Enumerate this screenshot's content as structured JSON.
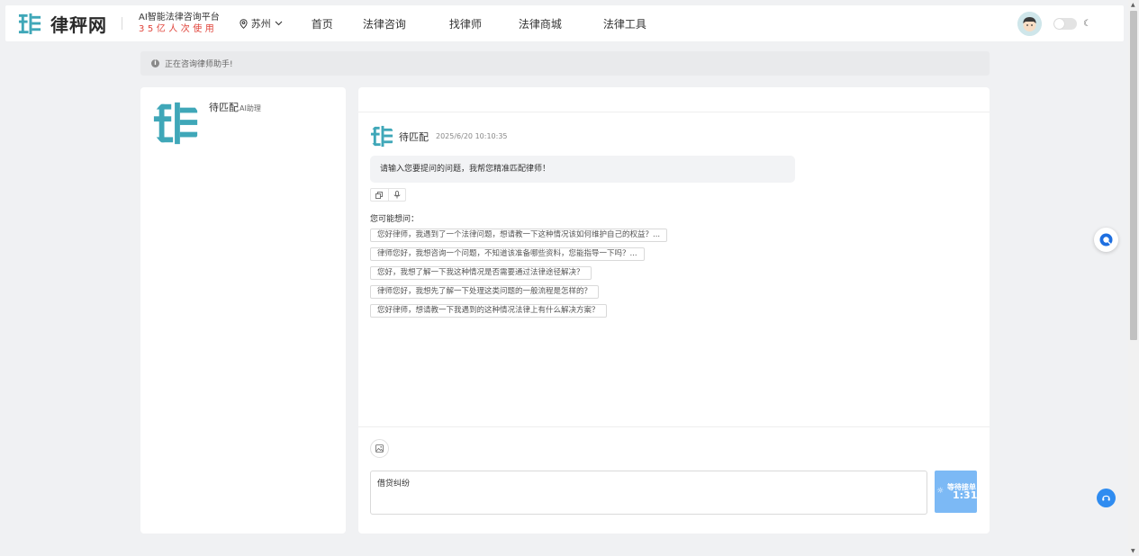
{
  "header": {
    "brand": "律秤网",
    "slogan_line1": "AI智能法律咨询平台",
    "slogan_line2": "35亿人次使用",
    "city": "苏州",
    "nav": [
      "首页",
      "法律咨询",
      "找律师",
      "法律商城",
      "法律工具"
    ],
    "moon_glyph": "☾"
  },
  "notice": {
    "text": "正在咨询律师助手!"
  },
  "left_panel": {
    "name": "待匹配",
    "tag": "AI助理"
  },
  "chat": {
    "sender": "待匹配",
    "time": "2025/6/20 10:10:35",
    "message": "请输入您要提问的问题，我帮您精准匹配律师！",
    "suggestions_title": "您可能想问：",
    "suggestions": [
      "您好律师，我遇到了一个法律问题，想请教一下这种情况该如何维护自己的权益？...",
      "律师您好，我想咨询一个问题，不知道该准备哪些资料，您能指导一下吗？...",
      "您好，我想了解一下我这种情况是否需要通过法律途径解决？",
      "律师您好，我想先了解一下处理这类问题的一般流程是怎样的？",
      "您好律师，想请教一下我遇到的这种情况法律上有什么解决方案？"
    ],
    "input_value": "借贷纠纷",
    "send_label": "等待接单",
    "countdown": "1:31"
  },
  "colors": {
    "accent": "#7cb9f5",
    "brand_teal": "#3fa7b8",
    "slogan_red": "#e0433a",
    "support_blue": "#2f8cf0"
  },
  "icons": [
    "location-icon",
    "chevron-down-icon",
    "info-icon",
    "copy-icon",
    "microphone-icon",
    "image-icon",
    "loading-icon",
    "chat-bubble-icon",
    "headset-icon",
    "moon-icon"
  ]
}
